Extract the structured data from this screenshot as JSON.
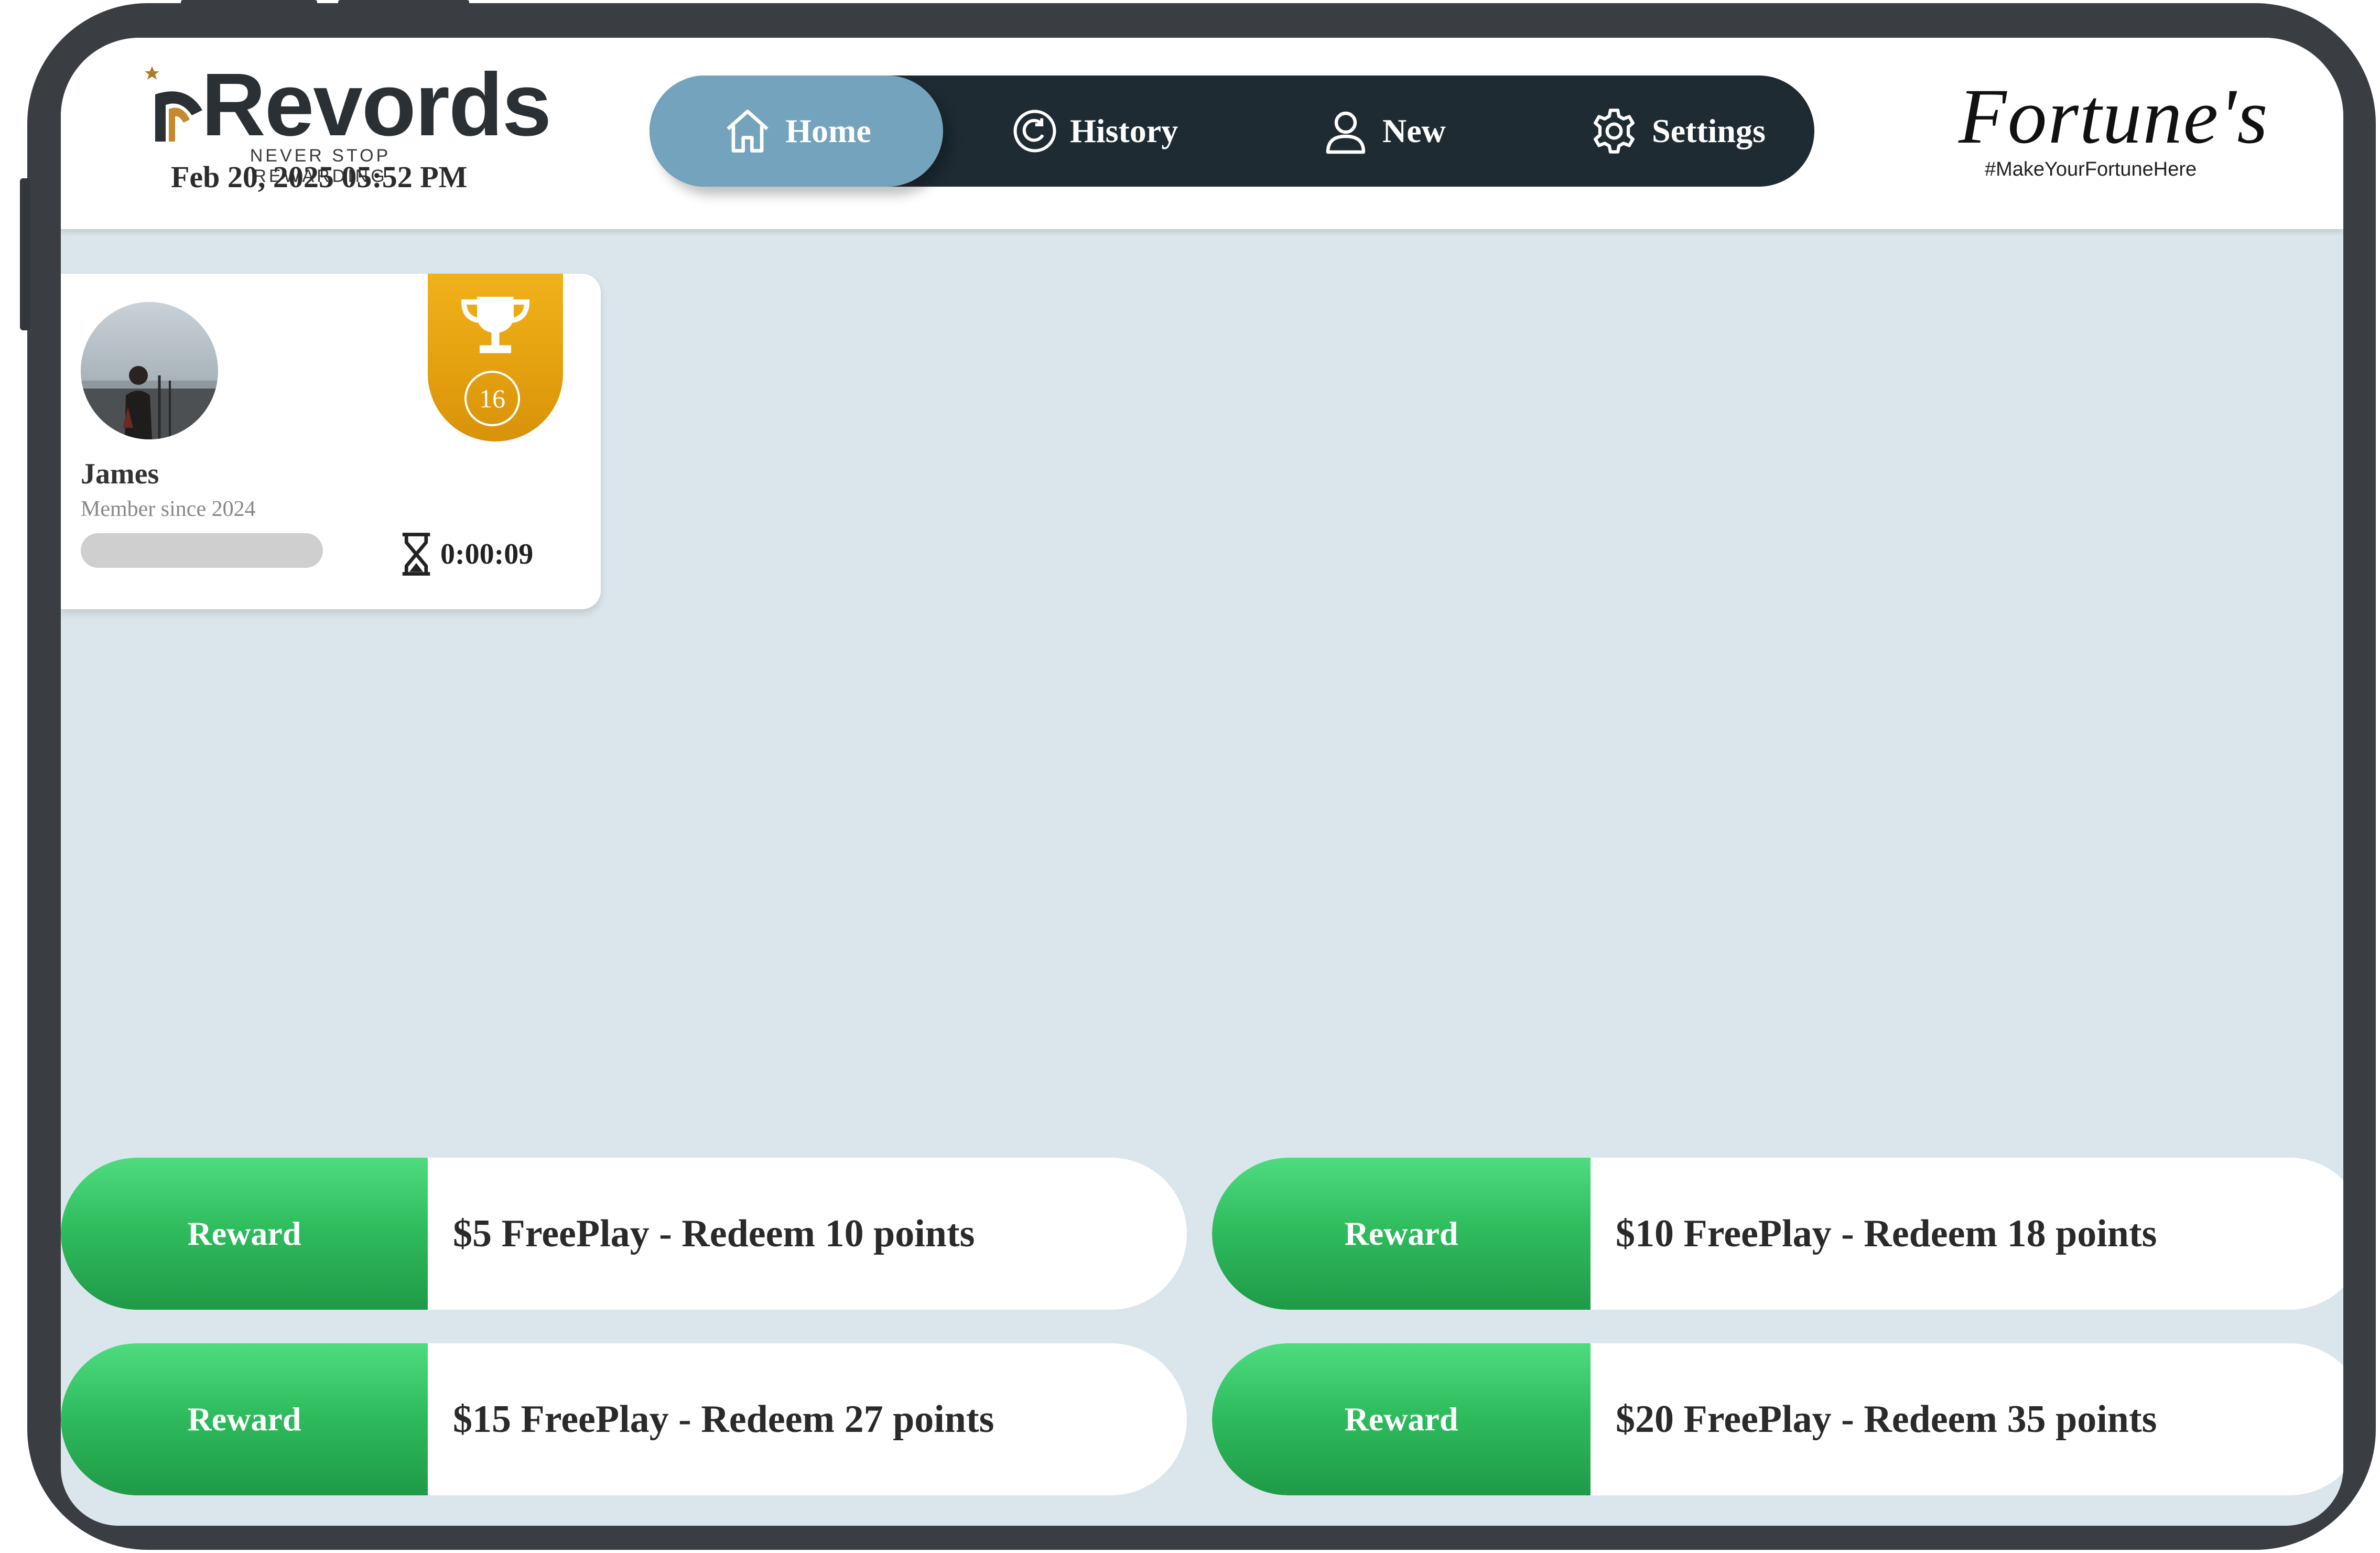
{
  "header": {
    "logo_text": "Revords",
    "logo_tagline": "NEVER STOP REWARDING",
    "datetime": "Feb 20, 2025 05:52 PM",
    "brand_logo_text": "Fortune's",
    "brand_tagline": "#MakeYourFortuneHere"
  },
  "nav": {
    "items": [
      {
        "label": "Home",
        "icon": "home-icon",
        "active": true
      },
      {
        "label": "History",
        "icon": "history-icon",
        "active": false
      },
      {
        "label": "New",
        "icon": "user-icon",
        "active": false
      },
      {
        "label": "Settings",
        "icon": "gear-icon",
        "active": false
      }
    ]
  },
  "player": {
    "name": "James",
    "member_since": "Member since 2024",
    "badge_count": "16",
    "badge_icon": "trophy-icon",
    "timer": "0:00:09",
    "timer_icon": "hourglass-icon",
    "progress": 0.0
  },
  "rewards": [
    {
      "button_label": "Reward",
      "description": "$5 FreePlay - Redeem 10 points"
    },
    {
      "button_label": "Reward",
      "description": "$10 FreePlay - Redeem 18 points"
    },
    {
      "button_label": "Reward",
      "description": "$15 FreePlay - Redeem 27 points"
    },
    {
      "button_label": "Reward",
      "description": "$20 FreePlay - Redeem 35 points"
    }
  ],
  "colors": {
    "nav_bg": "#1e2b33",
    "nav_active": "#73a3bd",
    "badge": "#e4a10f",
    "reward_green": "#2fbd5e",
    "background": "#dbe6ec"
  }
}
